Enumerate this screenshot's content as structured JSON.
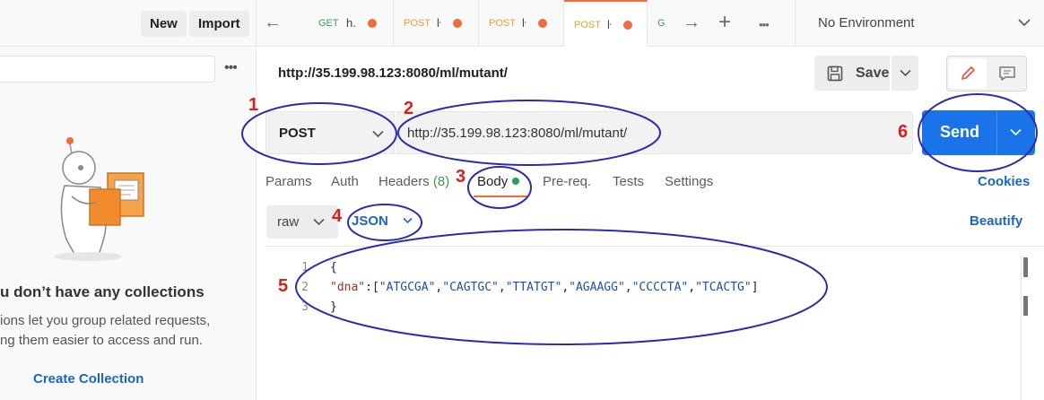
{
  "sidebar": {
    "new_label": "New",
    "import_label": "Import",
    "more_icon": "more-horizontal-icon",
    "empty_title": "u don’t have any collections",
    "empty_desc_1": "ions let you group related requests,",
    "empty_desc_2": "ng them easier to access and run.",
    "create_label": "Create Collection"
  },
  "tabs": {
    "items": [
      {
        "method": "GET",
        "name": "h."
      },
      {
        "method": "POST",
        "name": "ŀ"
      },
      {
        "method": "POST",
        "name": "ŀ"
      },
      {
        "method": "POST",
        "name": "ŀ",
        "active": true
      },
      {
        "method": "G",
        "name": ""
      }
    ],
    "environment": "No Environment"
  },
  "request": {
    "title": "http://35.199.98.123:8080/ml/mutant/",
    "save_label": "Save",
    "method": "POST",
    "url": "http://35.199.98.123:8080/ml/mutant/",
    "send_label": "Send"
  },
  "subtabs": {
    "params": "Params",
    "auth": "Auth",
    "headers": "Headers",
    "headers_count": "(8)",
    "body": "Body",
    "prereq": "Pre-req.",
    "tests": "Tests",
    "settings": "Settings",
    "cookies": "Cookies"
  },
  "body_options": {
    "type": "raw",
    "format": "JSON",
    "beautify": "Beautify"
  },
  "editor": {
    "line_numbers": [
      "1",
      "2",
      "3"
    ],
    "line1": "{",
    "line2_key": "\"dna\"",
    "line2_sep": ":[",
    "dna": [
      "\"ATGCGA\"",
      "\"CAGTGC\"",
      "\"TTATGT\"",
      "\"AGAAGG\"",
      "\"CCCCTA\"",
      "\"TCACTG\""
    ],
    "line2_end": "]",
    "line3": "}"
  },
  "annotations": {
    "labels": [
      "1",
      "2",
      "3",
      "4",
      "5",
      "6"
    ],
    "circle_color": "#2b2bb0",
    "number_color": "#d81e1e"
  },
  "colors": {
    "accent_orange": "#f26b3a",
    "send_blue": "#1a73e8",
    "link_blue": "#1a66c4"
  }
}
